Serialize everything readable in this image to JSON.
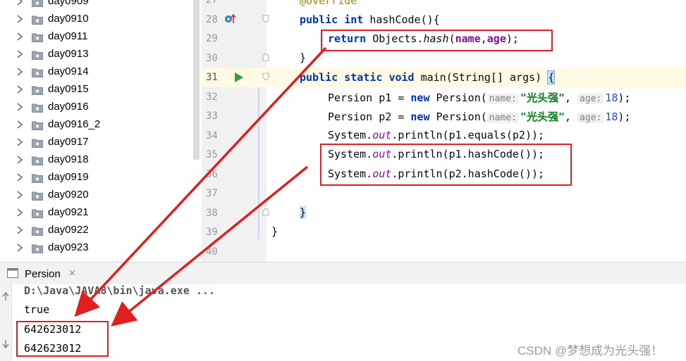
{
  "tree": {
    "folders": [
      "day0909",
      "day0910",
      "day0911",
      "day0913",
      "day0914",
      "day0915",
      "day0916",
      "day0916_2",
      "day0917",
      "day0918",
      "day0919",
      "day0920",
      "day0921",
      "day0922",
      "day0923"
    ]
  },
  "editor": {
    "line_numbers": [
      "27",
      "28",
      "29",
      "30",
      "31",
      "32",
      "33",
      "34",
      "35",
      "36",
      "37",
      "38",
      "39",
      "40"
    ],
    "lines": {
      "l27": {
        "annotation": "@Override"
      },
      "l28": {
        "kw1": "public",
        "kw2": "int",
        "rest": " hashCode(){"
      },
      "l29": {
        "kw": "return",
        "pre": " Objects.",
        "method": "hash",
        "open": "(",
        "f1": "name",
        "comma": ",",
        "f2": "age",
        "close": ");"
      },
      "l30": {
        "text": "}"
      },
      "l31": {
        "kw1": "public",
        "kw2": "static",
        "kw3": "void",
        "rest": " main(String[] args) ",
        "brace": "{"
      },
      "l32": {
        "pre": "Persion p1 = ",
        "kw": "new",
        "mid": " Persion(",
        "hint1": "name:",
        "str": "\"光头强\"",
        "comma": ",",
        "hint2": "age:",
        "num": "18",
        "close": ");"
      },
      "l33": {
        "pre": "Persion p2 = ",
        "kw": "new",
        "mid": " Persion(",
        "hint1": "name:",
        "str": "\"光头强\"",
        "comma": ",",
        "hint2": "age:",
        "num": "18",
        "close": ");"
      },
      "l34": {
        "pre": "System.",
        "out": "out",
        "rest": ".println(p1.equals(p2));"
      },
      "l35": {
        "pre": "System.",
        "out": "out",
        "rest": ".println(p1.hashCode());"
      },
      "l36": {
        "pre": "System.",
        "out": "out",
        "rest": ".println(p2.hashCode());"
      },
      "l38": {
        "text": "}"
      },
      "l39": {
        "text": "}"
      }
    }
  },
  "run_panel": {
    "tab_label": "Persion",
    "tab_close": "×",
    "command": "D:\\Java\\JAVA8\\bin\\java.exe ...",
    "output": [
      "true",
      "642623012",
      "642623012"
    ]
  },
  "watermark": "CSDN @梦想成为光头强！",
  "colors": {
    "annotation_box": "#e02020",
    "arrow": "#e02020",
    "keyword": "#0033b3",
    "field": "#871094",
    "string": "#067d17"
  }
}
